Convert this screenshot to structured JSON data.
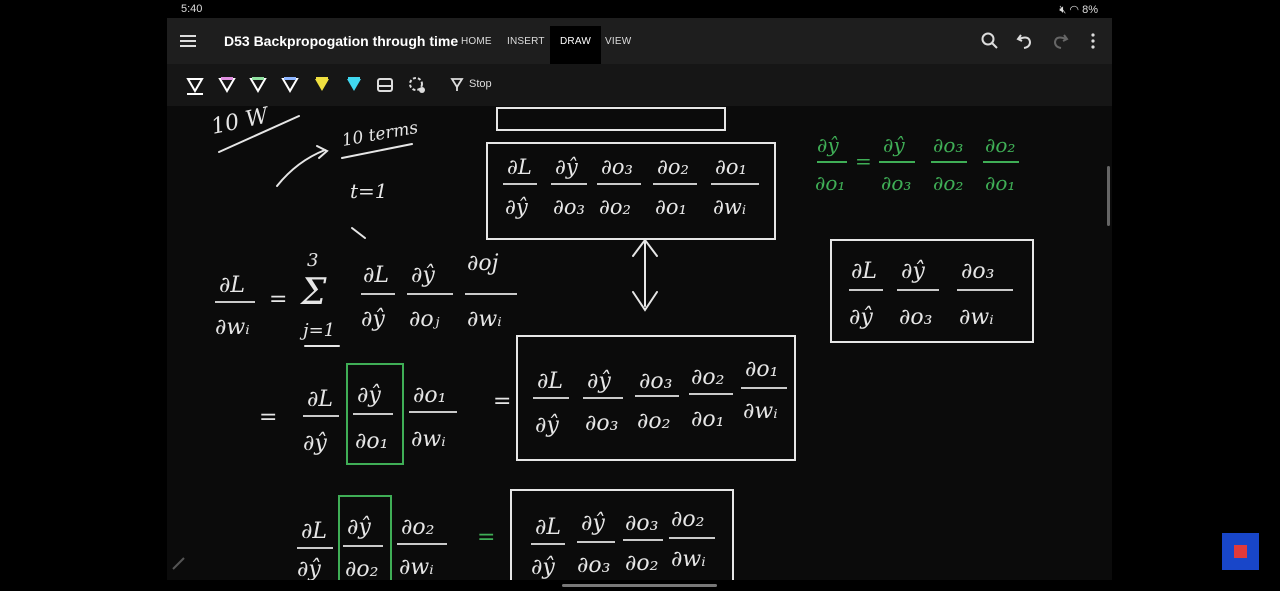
{
  "status_bar": {
    "time": "5:40",
    "right_text": "8%"
  },
  "app_bar": {
    "title": "D53 Backpropogation through time",
    "tabs": [
      {
        "label": "HOME"
      },
      {
        "label": "INSERT"
      },
      {
        "label": "DRAW",
        "active": true
      },
      {
        "label": "VIEW"
      }
    ]
  },
  "toolbar": {
    "pens": [
      {
        "name": "pen-white",
        "color": "#ffffff"
      },
      {
        "name": "pen-pink",
        "color": "#e08fe0"
      },
      {
        "name": "pen-green",
        "color": "#8fe0a0"
      },
      {
        "name": "pen-blue",
        "color": "#8fb6ff"
      },
      {
        "name": "highlighter-yellow",
        "color": "#f0e040"
      },
      {
        "name": "highlighter-cyan",
        "color": "#40d8f0"
      },
      {
        "name": "eraser",
        "color": "#cfcfcf"
      },
      {
        "name": "lasso",
        "color": "#cfcfcf"
      }
    ],
    "stop_label": "Stop"
  },
  "handwriting": {
    "ink_white": "#e6e6e6",
    "ink_green": "#3fae56",
    "top_note_a": "10 W",
    "top_note_b": "10 terms",
    "t_equals": "t=1",
    "sum_upper": "3",
    "sum_lower": "j=1",
    "eq_sign": "=",
    "box_top_frac": [
      "∂L/∂ŷ",
      "∂ŷ/∂o3",
      "∂o3/∂o2",
      "∂o2/∂o1",
      "∂o1/∂wi"
    ],
    "green_frac": [
      "∂ŷ/∂o1",
      "=",
      "∂ŷ/∂o3",
      "∂o3/∂o2",
      "∂o2/∂o1"
    ],
    "right_box_frac": [
      "∂L/∂ŷ",
      "∂ŷ/∂o3",
      "∂o3/∂wi"
    ],
    "main_lhs": "∂L/∂wi",
    "main_sum_frac": [
      "∂L/∂ŷ",
      "∂ŷ/∂oj",
      "∂oj/∂wi"
    ],
    "row2": [
      "∂L/∂ŷ",
      "∂ŷ/∂o1",
      "∂o1/∂wi"
    ],
    "row2_box": [
      "∂L/∂ŷ",
      "∂ŷ/∂o3",
      "∂o3/∂o2",
      "∂o2/∂o1",
      "∂o1/∂wi"
    ],
    "row3": [
      "∂L/∂ŷ",
      "∂ŷ/∂o2",
      "∂o2/∂wi"
    ],
    "row3_box": [
      "∂L/∂ŷ",
      "∂ŷ/∂o3",
      "∂o3/∂o2",
      "∂o2/∂wi"
    ]
  }
}
